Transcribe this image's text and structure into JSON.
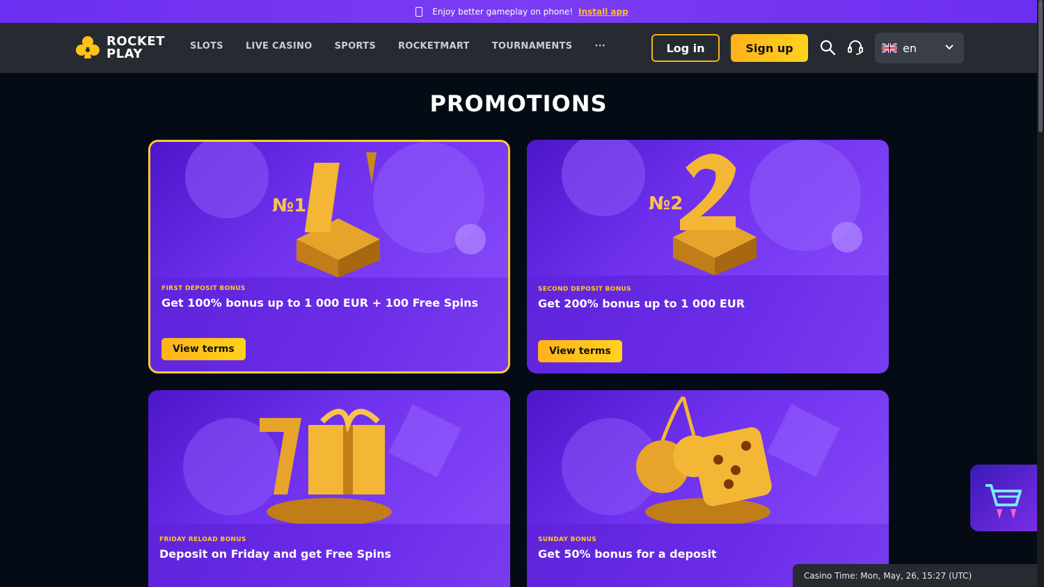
{
  "banner": {
    "text": "Enjoy better gameplay on phone!",
    "link": "Install app"
  },
  "brand": {
    "line1": "ROCKET",
    "line2": "PLAY"
  },
  "nav": [
    "SLOTS",
    "LIVE CASINO",
    "SPORTS",
    "ROCKETMART",
    "TOURNAMENTS",
    "···"
  ],
  "header": {
    "login": "Log in",
    "signup": "Sign up",
    "language": "en"
  },
  "page": {
    "title": "PROMOTIONS"
  },
  "promos": [
    {
      "category": "FIRST DEPOSIT BONUS",
      "headline": "Get 100% bonus up to 1 000 EUR + 100 Free Spins",
      "button": "View terms",
      "badge": "№1"
    },
    {
      "category": "SECOND DEPOSIT BONUS",
      "headline": "Get 200% bonus up to 1 000 EUR",
      "button": "View terms",
      "badge": "№2"
    },
    {
      "category": "FRIDAY RELOAD BONUS",
      "headline": "Deposit on Friday and get Free Spins"
    },
    {
      "category": "SUNDAY BONUS",
      "headline": "Get 50% bonus for a deposit"
    }
  ],
  "footer": {
    "casino_time": "Casino Time: Mon, May, 26, 15:27 (UTC)"
  },
  "colors": {
    "accent": "#ffc21a",
    "purple": "#6a2be7",
    "background": "#040b14",
    "header": "#262a31"
  }
}
